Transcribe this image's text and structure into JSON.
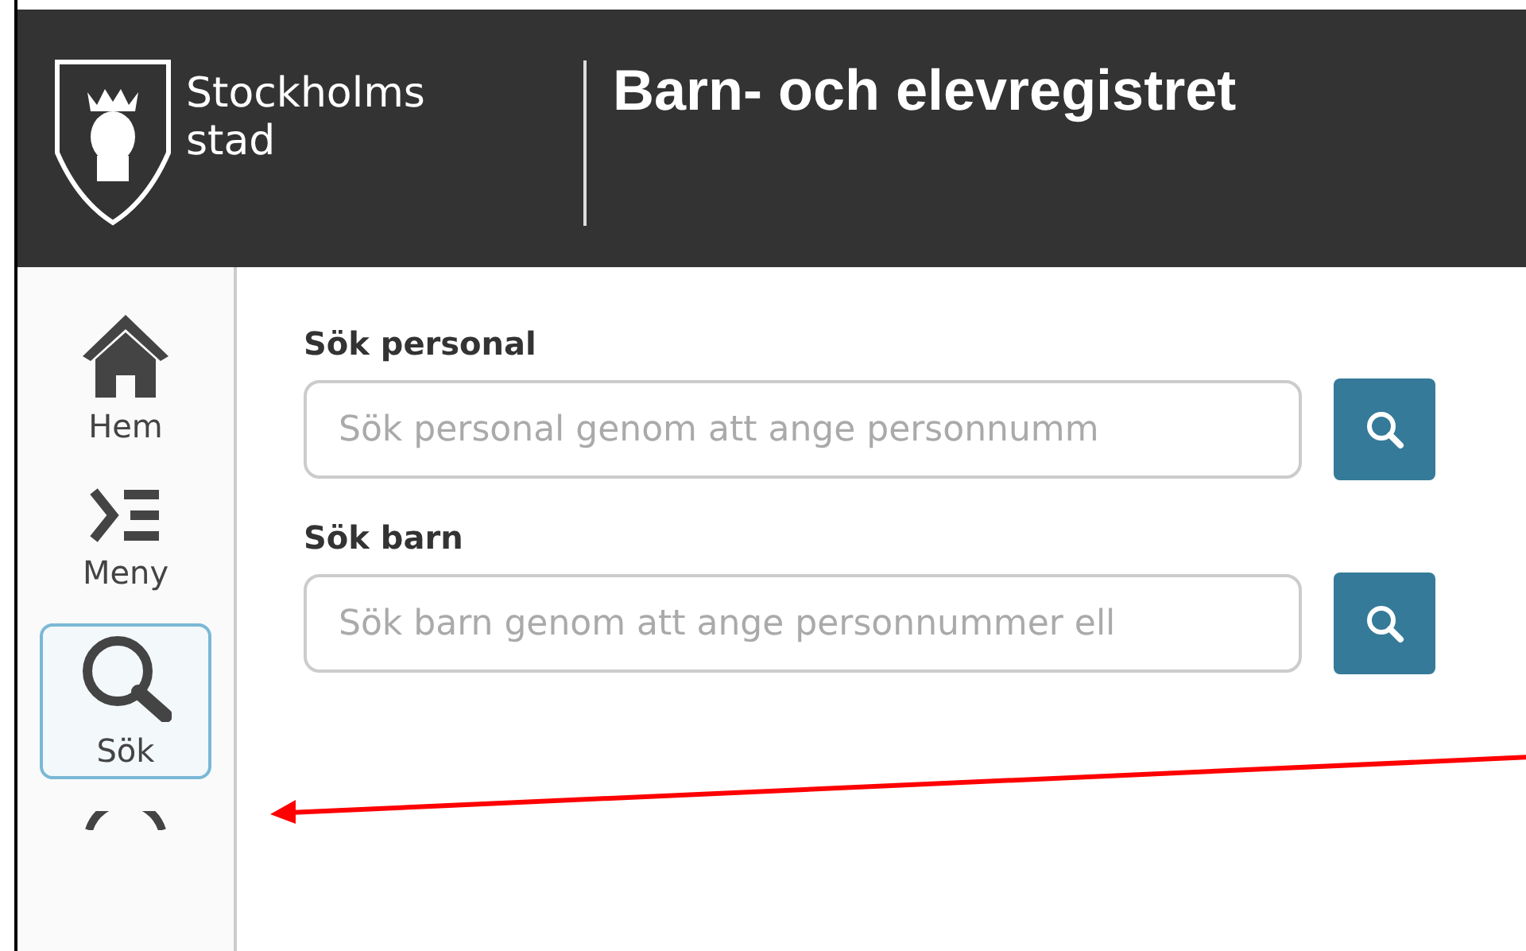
{
  "header": {
    "logo_lines": [
      "Stockholms",
      "stad"
    ],
    "title": "Barn- och elevregistret"
  },
  "sidebar": {
    "items": [
      {
        "kind": "home",
        "label": "Hem",
        "selected": false
      },
      {
        "kind": "menu",
        "label": "Meny",
        "selected": false
      },
      {
        "kind": "search",
        "label": "Sök",
        "selected": true
      },
      {
        "kind": "circle",
        "selected": false
      }
    ]
  },
  "search_sections": [
    {
      "label": "Sök personal",
      "placeholder": "Sök personal genom att ange personnumm"
    },
    {
      "label": "Sök barn",
      "placeholder": "Sök barn genom att ange personnummer ell"
    }
  ]
}
